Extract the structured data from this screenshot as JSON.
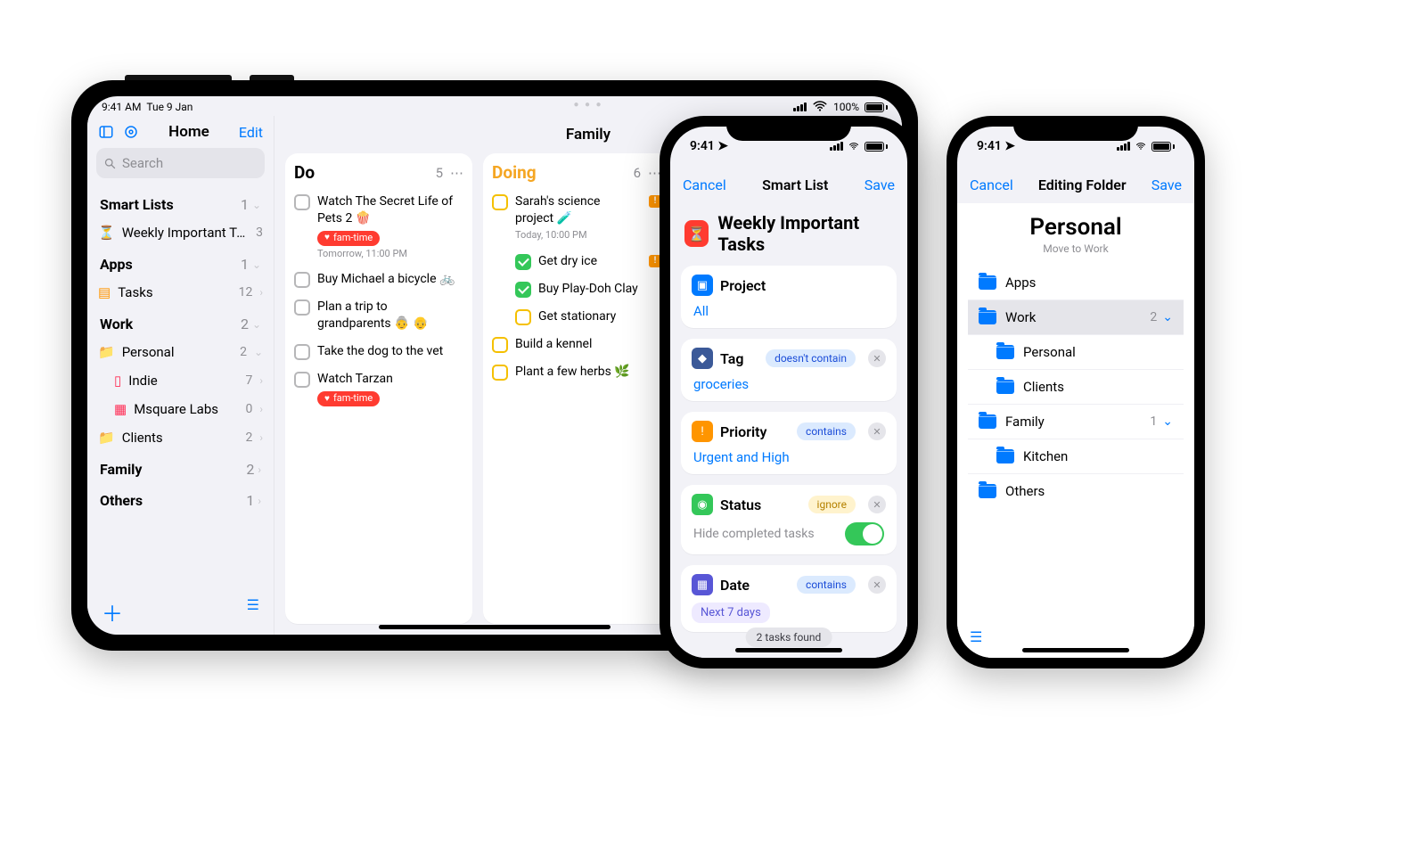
{
  "ipad": {
    "status_time": "9:41 AM",
    "status_date": "Tue 9 Jan",
    "status_batt": "100%",
    "sidebar": {
      "title": "Home",
      "edit": "Edit",
      "search_placeholder": "Search",
      "sections": [
        {
          "label": "Smart Lists",
          "count": "1"
        },
        {
          "label": "Apps",
          "count": "1"
        },
        {
          "label": "Work",
          "count": "2"
        },
        {
          "label": "Family",
          "count": "2"
        },
        {
          "label": "Others",
          "count": "1"
        }
      ],
      "smartlists": [
        {
          "label": "Weekly Important Tasks",
          "count": "3"
        }
      ],
      "apps": [
        {
          "label": "Tasks",
          "count": "12"
        }
      ],
      "work": [
        {
          "label": "Personal",
          "count": "2"
        },
        {
          "label": "Indie",
          "count": "7",
          "indent": 2
        },
        {
          "label": "Msquare Labs",
          "count": "0",
          "indent": 2
        },
        {
          "label": "Clients",
          "count": "2"
        }
      ]
    },
    "board": {
      "title": "Family",
      "col_do": {
        "title": "Do",
        "count": "5",
        "tasks": [
          {
            "text": "Watch The Secret Life of Pets 2 🍿",
            "tag": "fam-time",
            "sub": "Tomorrow, 11:00 PM"
          },
          {
            "text": "Buy Michael a bicycle 🚲"
          },
          {
            "text": "Plan a trip to grandparents 👵 👴"
          },
          {
            "text": "Take the dog to the vet"
          },
          {
            "text": "Watch Tarzan",
            "tag": "fam-time"
          }
        ]
      },
      "col_doing": {
        "title": "Doing",
        "count": "6",
        "tasks": [
          {
            "text": "Sarah's science project 🧪",
            "sub": "Today, 10:00 PM",
            "flag": true,
            "children": [
              {
                "text": "Get dry ice",
                "done": true,
                "flag": true
              },
              {
                "text": "Buy Play-Doh Clay",
                "done": true
              },
              {
                "text": "Get stationary"
              }
            ]
          },
          {
            "text": "Build a kennel"
          },
          {
            "text": "Plant a few herbs 🌿"
          }
        ]
      }
    }
  },
  "smartlist": {
    "status_time": "9:41",
    "nav_cancel": "Cancel",
    "nav_title": "Smart List",
    "nav_save": "Save",
    "title": "Weekly Important Tasks",
    "cards": {
      "project": {
        "label": "Project",
        "value": "All"
      },
      "tag": {
        "label": "Tag",
        "pill": "doesn't contain",
        "value": "groceries"
      },
      "priority": {
        "label": "Priority",
        "pill": "contains",
        "value": "Urgent and High"
      },
      "status": {
        "label": "Status",
        "pill": "ignore",
        "hint": "Hide completed tasks"
      },
      "date": {
        "label": "Date",
        "pill": "contains",
        "chip": "Next 7 days"
      }
    },
    "found": "2 tasks found"
  },
  "editfolder": {
    "status_time": "9:41",
    "nav_cancel": "Cancel",
    "nav_title": "Editing Folder",
    "nav_save": "Save",
    "title": "Personal",
    "sub": "Move to Work",
    "rows": [
      {
        "label": "Apps"
      },
      {
        "label": "Work",
        "count": "2",
        "sel": true,
        "open": true
      },
      {
        "label": "Personal",
        "child": true
      },
      {
        "label": "Clients",
        "child": true
      },
      {
        "label": "Family",
        "count": "1",
        "open": true
      },
      {
        "label": "Kitchen",
        "child": true
      },
      {
        "label": "Others"
      }
    ]
  }
}
